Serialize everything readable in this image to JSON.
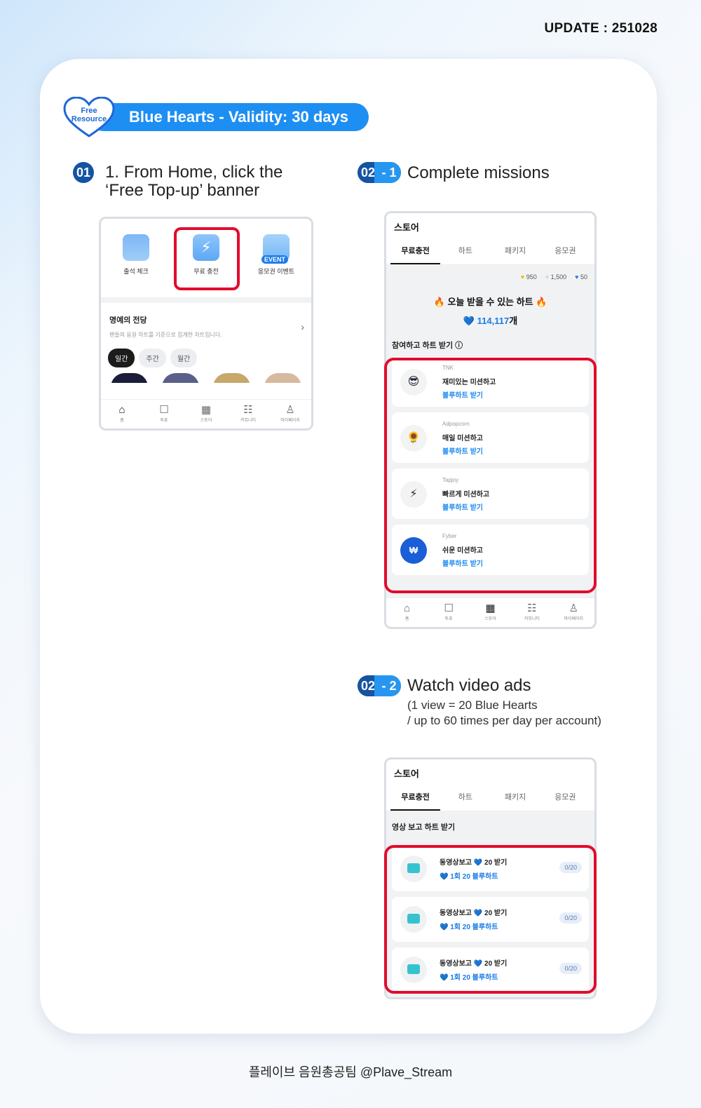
{
  "update": "UPDATE : 251028",
  "badge": {
    "line1": "Free",
    "line2": "Resource"
  },
  "header": "Blue Hearts - Validity: 30 days",
  "step1": {
    "num": "01",
    "title": "1. From Home, click the ‘Free Top-up’ banner"
  },
  "step21": {
    "num_a": "02",
    "num_b": "- 1",
    "title": "Complete missions"
  },
  "step22": {
    "num_a": "02",
    "num_b": "- 2",
    "title": "Watch video ads",
    "sub1": "(1 view = 20 Blue Hearts",
    "sub2": "/ up to 60 times per day per account)"
  },
  "home": {
    "icons": [
      {
        "label": "출석 체크",
        "icon": "calendar-icon"
      },
      {
        "label": "무료 충전",
        "icon": "bolt-icon"
      },
      {
        "label": "응모권 이벤트",
        "icon": "event-heart-icon",
        "badge": "EVENT"
      }
    ],
    "hall_title": "명예의 전당",
    "hall_sub": "팬들의 응원 하트를 기준으로 집계한 차트입니다.",
    "chips": [
      "일간",
      "주간",
      "월간"
    ],
    "nav": [
      "홈",
      "투표",
      "스토어",
      "커뮤니티",
      "마이페이지"
    ]
  },
  "store": {
    "title": "스토어",
    "tabs": [
      "무료충전",
      "하트",
      "패키지",
      "응모권"
    ],
    "balances": [
      "950",
      "1,500",
      "50"
    ],
    "today": "🔥 오늘 받을 수 있는 하트 🔥",
    "count": "114,117",
    "count_unit": "개",
    "section": "참여하고 하트 받기 ⓘ",
    "missions": [
      {
        "provider": "TNK",
        "title": "재미있는 미션하고",
        "link": "블루하트 받기",
        "icon": "😎"
      },
      {
        "provider": "Adpopcorn",
        "title": "매일 미션하고",
        "link": "블루하트 받기",
        "icon": "🌻"
      },
      {
        "provider": "Tapjoy",
        "title": "빠르게 미션하고",
        "link": "블루하트 받기",
        "icon": "⚡"
      },
      {
        "provider": "Fyber",
        "title": "쉬운 미션하고",
        "link": "블루하트 받기",
        "icon": "₩"
      }
    ],
    "nav": [
      "홈",
      "투표",
      "스토어",
      "커뮤니티",
      "마이페이지"
    ]
  },
  "video": {
    "section": "영상 보고 하트 받기",
    "rows": [
      {
        "title": "동영상보고 💙 20 받기",
        "link": "💙 1회 20 블루하트",
        "count": "0/20"
      },
      {
        "title": "동영상보고 💙 20 받기",
        "link": "💙 1회 20 블루하트",
        "count": "0/20"
      },
      {
        "title": "동영상보고 💙 20 받기",
        "link": "💙 1회 20 블루하트",
        "count": "0/20"
      }
    ]
  },
  "footer": "플레이브 음원총공팀 @Plave_Stream"
}
